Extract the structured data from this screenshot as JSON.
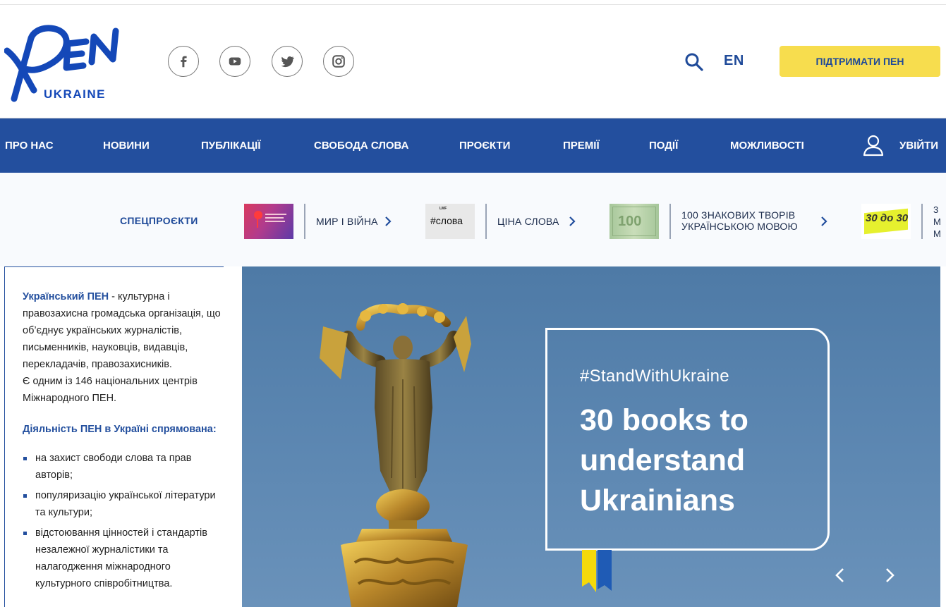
{
  "header": {
    "logo": {
      "main": "ПЕН",
      "sub": "UKRAINE"
    },
    "social": [
      {
        "name": "facebook",
        "icon": "facebook-icon"
      },
      {
        "name": "youtube",
        "icon": "youtube-icon"
      },
      {
        "name": "twitter",
        "icon": "twitter-icon"
      },
      {
        "name": "instagram",
        "icon": "instagram-icon"
      }
    ],
    "search_icon": "search-icon",
    "language": "EN",
    "support_label": "ПІДТРИМАТИ ПЕН"
  },
  "nav": {
    "items": [
      "ПРО НАС",
      "НОВИНИ",
      "ПУБЛІКАЦІЇ",
      "СВОБОДА СЛОВА",
      "ПРОЄКТИ",
      "ПРЕМІЇ",
      "ПОДІЇ",
      "МОЖЛИВОСТІ"
    ],
    "login": "УВІЙТИ",
    "user_icon": "user-icon"
  },
  "special_projects": {
    "label": "СПЕЦПРОЄКТИ",
    "items": [
      {
        "title": "МИР І ВІЙНА"
      },
      {
        "title": "ЦІНА СЛОВА",
        "thumb_text": "#слова",
        "thumb_small": "LMF"
      },
      {
        "title_line1": "100 ЗНАКОВИХ ТВОРІВ",
        "title_line2": "УКРАЇНСЬКОЮ МОВОЮ",
        "thumb_text": "100"
      },
      {
        "title_partial": [
          "3",
          "М",
          "М"
        ],
        "thumb_text": "30 до 30"
      }
    ]
  },
  "sidebar": {
    "org_name": "Український ПЕН",
    "intro": " - культурна і правозахисна громадська організація, що об’єднує українських журналістів, письменників, науковців, видавців, перекладачів, правозахисників.",
    "centers": "Є одним із 146 національних центрів Міжнародного ПЕН.",
    "activity_heading": "Діяльність ПЕН в Україні спрямована:",
    "activities": [
      "на захист свободи слова та прав авторів;",
      "популяризацію української літератури та культури;",
      "відстоювання цінностей і стандартів незалежної журналістики та налагодження міжнародного культурного співробітництва."
    ]
  },
  "hero": {
    "tag": "#StandWithUkraine",
    "title": "30 books to understand Ukrainians",
    "colors": {
      "blue": "#1f5bb5",
      "yellow": "#f5d90a"
    }
  },
  "colors": {
    "brand_blue": "#234f9e",
    "accent_yellow": "#f7dd4e"
  }
}
